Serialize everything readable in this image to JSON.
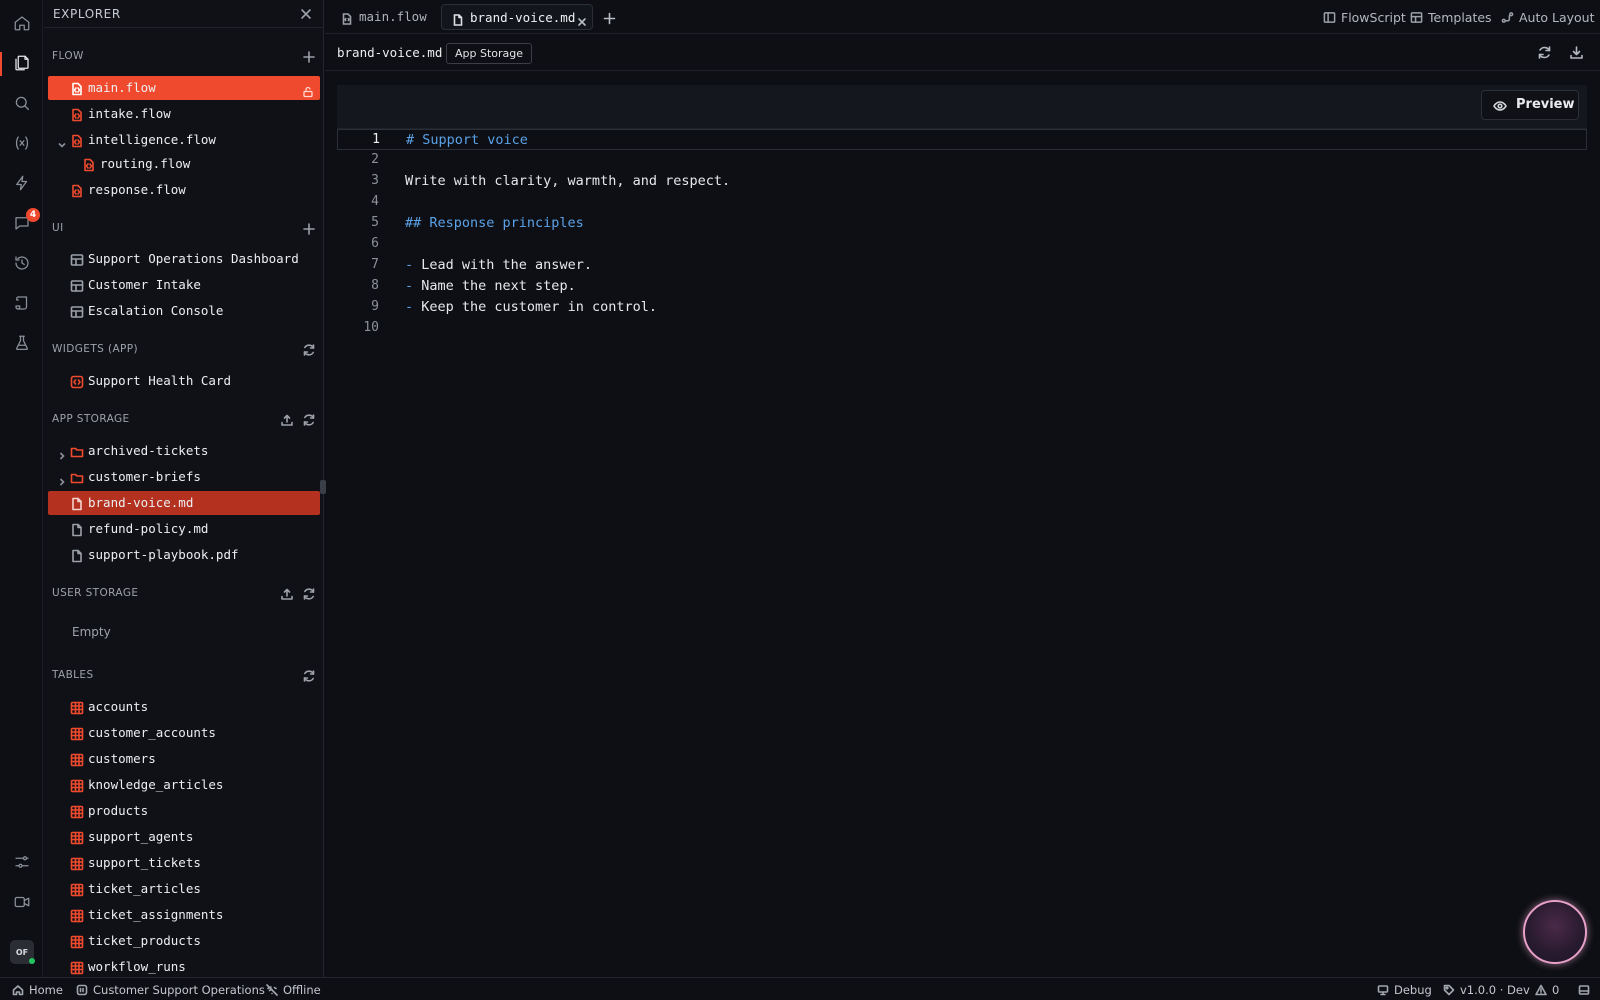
{
  "activity_bar": {
    "notification_badge": "4",
    "user_initials": "OF"
  },
  "explorer": {
    "title": "EXPLORER",
    "sections": {
      "flow": {
        "title": "FLOW",
        "items": [
          {
            "label": "main.flow"
          },
          {
            "label": "intake.flow"
          },
          {
            "label": "intelligence.flow"
          },
          {
            "label": "routing.flow"
          },
          {
            "label": "response.flow"
          }
        ]
      },
      "ui": {
        "title": "UI",
        "items": [
          {
            "label": "Support Operations Dashboard"
          },
          {
            "label": "Customer Intake"
          },
          {
            "label": "Escalation Console"
          }
        ]
      },
      "widgets": {
        "title": "WIDGETS (APP)",
        "items": [
          {
            "label": "Support Health Card"
          }
        ]
      },
      "app_storage": {
        "title": "APP STORAGE",
        "items": [
          {
            "label": "archived-tickets"
          },
          {
            "label": "customer-briefs"
          },
          {
            "label": "brand-voice.md"
          },
          {
            "label": "refund-policy.md"
          },
          {
            "label": "support-playbook.pdf"
          }
        ]
      },
      "user_storage": {
        "title": "USER STORAGE",
        "empty_text": "Empty"
      },
      "tables": {
        "title": "TABLES",
        "items": [
          {
            "label": "accounts"
          },
          {
            "label": "customer_accounts"
          },
          {
            "label": "customers"
          },
          {
            "label": "knowledge_articles"
          },
          {
            "label": "products"
          },
          {
            "label": "support_agents"
          },
          {
            "label": "support_tickets"
          },
          {
            "label": "ticket_articles"
          },
          {
            "label": "ticket_assignments"
          },
          {
            "label": "ticket_products"
          },
          {
            "label": "workflow_runs"
          }
        ]
      }
    }
  },
  "tabs": [
    {
      "label": "main.flow"
    },
    {
      "label": "brand-voice.md"
    }
  ],
  "toolbar_right": {
    "flowscript": "FlowScript",
    "templates": "Templates",
    "auto_layout": "Auto Layout"
  },
  "path_bar": {
    "filename": "brand-voice.md",
    "badge": "App Storage"
  },
  "editor": {
    "preview_label": "Preview",
    "lines": [
      {
        "n": "1",
        "text": "# Support voice"
      },
      {
        "n": "2",
        "text": ""
      },
      {
        "n": "3",
        "text": "Write with clarity, warmth, and respect."
      },
      {
        "n": "4",
        "text": ""
      },
      {
        "n": "5",
        "text": "## Response principles"
      },
      {
        "n": "6",
        "text": ""
      },
      {
        "n": "7",
        "bullet": "-",
        "text": " Lead with the answer."
      },
      {
        "n": "8",
        "bullet": "-",
        "text": " Name the next step."
      },
      {
        "n": "9",
        "bullet": "-",
        "text": " Keep the customer in control."
      },
      {
        "n": "10",
        "text": ""
      }
    ]
  },
  "status_bar": {
    "home": "Home",
    "project": "Customer Support Operations",
    "connection": "Offline",
    "debug": "Debug",
    "version": "v1.0.0 · Dev",
    "warnings": "0"
  },
  "colors": {
    "accent": "#f04a2e",
    "selected_secondary": "#b5311f",
    "heading_blue": "#5aa2e8",
    "background": "#0d0f14"
  },
  "icons": {
    "activity": [
      "home-icon",
      "files-icon",
      "search-icon",
      "variable-icon",
      "bolt-icon",
      "chat-icon",
      "history-icon",
      "scroll-icon",
      "flask-icon",
      "sliders-icon",
      "video-icon"
    ],
    "flow_file": "flow-file-icon",
    "ui_page": "layout-icon",
    "widget": "widget-icon",
    "folder": "folder-icon",
    "file": "file-icon",
    "table": "table-icon"
  }
}
